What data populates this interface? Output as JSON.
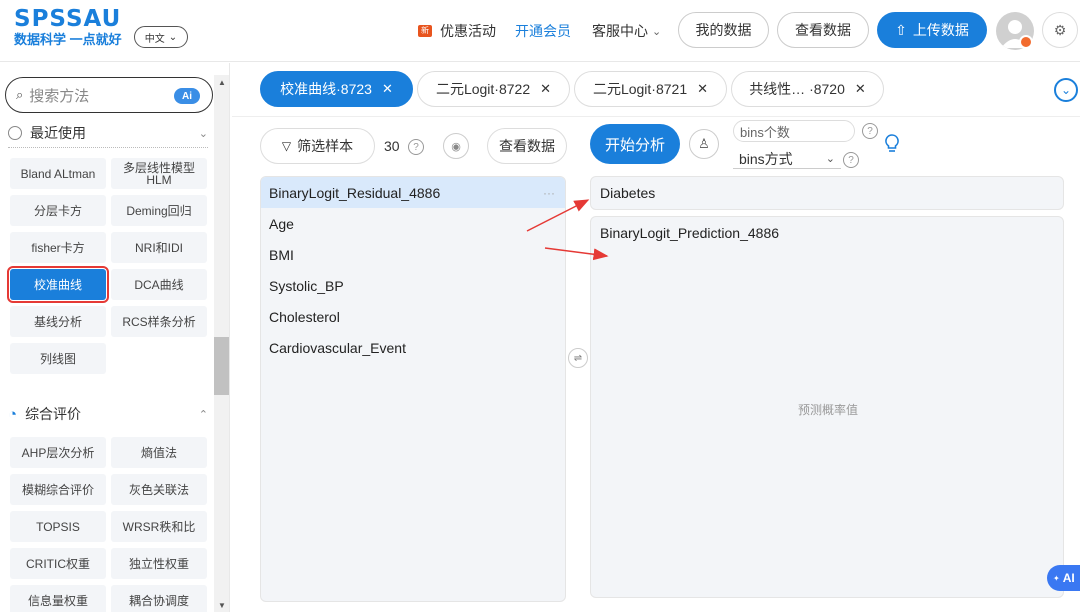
{
  "header": {
    "logo": "SPSSAU",
    "slogan": "数据科学 一点就好",
    "lang": "中文",
    "promo": "优惠活动",
    "promo_badge": "新",
    "vip": "开通会员",
    "service": "客服中心",
    "my_data": "我的数据",
    "view_data": "查看数据",
    "upload": "上传数据"
  },
  "sidebar": {
    "search_placeholder": "搜索方法",
    "ai_chip": "Ai",
    "recent_title": "最近使用",
    "recent_items": [
      "Bland ALtman",
      "多层线性模型HLM",
      "分层卡方",
      "Deming回归",
      "fisher卡方",
      "NRI和IDI",
      "校准曲线",
      "DCA曲线",
      "基线分析",
      "RCS样条分析",
      "列线图"
    ],
    "eval_title": "综合评价",
    "eval_items": [
      "AHP层次分析",
      "熵值法",
      "模糊综合评价",
      "灰色关联法",
      "TOPSIS",
      "WRSR秩和比",
      "CRITIC权重",
      "独立性权重",
      "信息量权重",
      "耦合协调度"
    ]
  },
  "tabs": [
    {
      "label": "校准曲线·8723",
      "active": true
    },
    {
      "label": "二元Logit·8722",
      "active": false
    },
    {
      "label": "二元Logit·8721",
      "active": false
    },
    {
      "label": "共线性… ·8720",
      "active": false
    }
  ],
  "toolbar": {
    "filter": "筛选样本",
    "count": "30",
    "view_data": "查看数据",
    "start": "开始分析",
    "bins_count_placeholder": "bins个数",
    "bins_method": "bins方式"
  },
  "variables": [
    "BinaryLogit_Residual_4886",
    "Age",
    "BMI",
    "Systolic_BP",
    "Cholesterol",
    "Cardiovascular_Event"
  ],
  "target": "Diabetes",
  "prediction": {
    "value": "BinaryLogit_Prediction_4886",
    "hint": "预测概率值"
  },
  "ai_float": "AI",
  "colors": {
    "primary": "#1a7fdb",
    "highlight": "#e53935"
  }
}
